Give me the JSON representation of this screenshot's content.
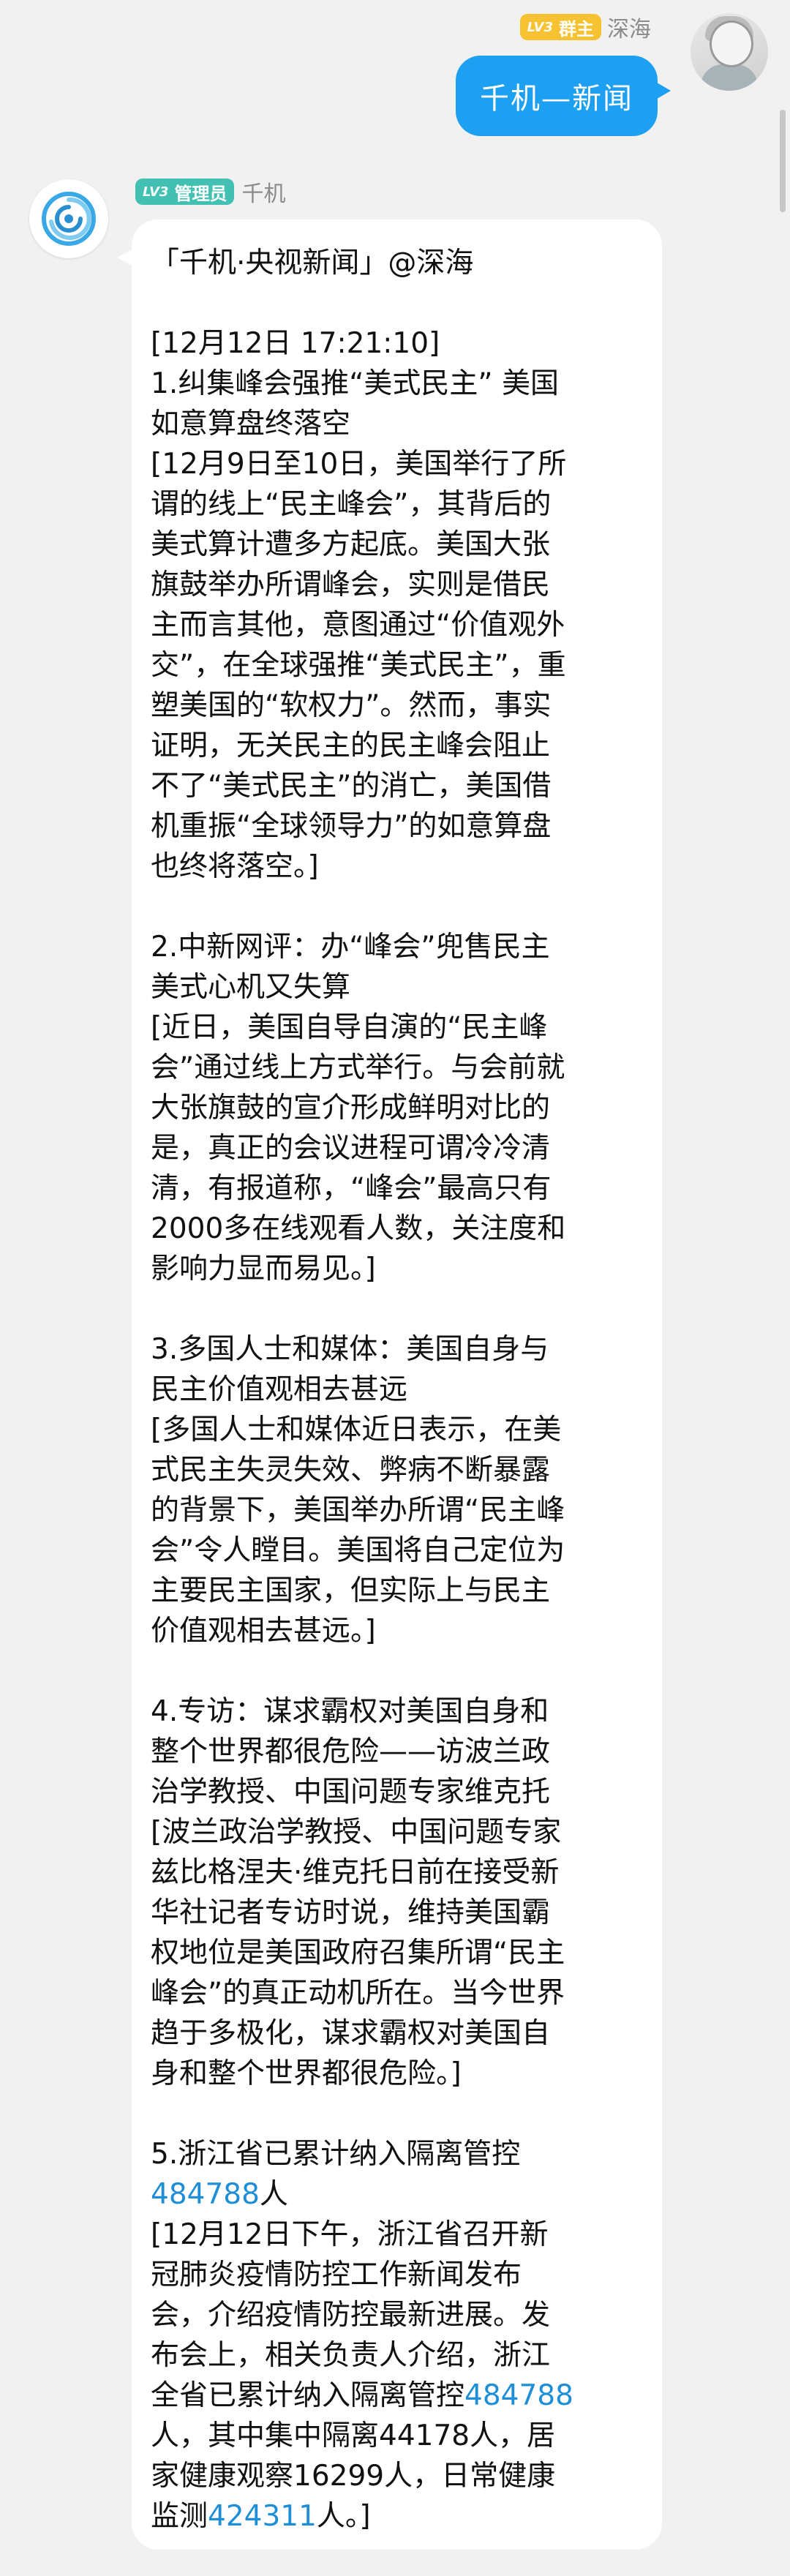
{
  "outgoing": {
    "badge_level": "LV3",
    "badge_role": "群主",
    "sender": "深海",
    "text": "千机—新闻"
  },
  "incoming": {
    "badge_level": "LV3",
    "badge_role": "管理员",
    "sender": "千机",
    "lines": [
      "「千机·央视新闻」@深海",
      "",
      "[12月12日 17:21:10]",
      "1.纠集峰会强推“美式民主” 美国",
      "如意算盘终落空",
      "[12月9日至10日，美国举行了所",
      "谓的线上“民主峰会”，其背后的",
      "美式算计遭多方起底。美国大张",
      "旗鼓举办所谓峰会，实则是借民",
      "主而言其他，意图通过“价值观外",
      "交”，在全球强推“美式民主”，重",
      "塑美国的“软权力”。然而，事实",
      "证明，无关民主的民主峰会阻止",
      "不了“美式民主”的消亡，美国借",
      "机重振“全球领导力”的如意算盘",
      "也终将落空。]",
      "",
      "2.中新网评：办“峰会”兜售民主",
      "美式心机又失算",
      "[近日，美国自导自演的“民主峰",
      "会”通过线上方式举行。与会前就",
      "大张旗鼓的宣介形成鲜明对比的",
      "是，真正的会议进程可谓冷冷清",
      "清，有报道称，“峰会”最高只有",
      "2000多在线观看人数，关注度和",
      "影响力显而易见。]",
      "",
      "3.多国人士和媒体：美国自身与",
      "民主价值观相去甚远",
      "[多国人士和媒体近日表示，在美",
      "式民主失灵失效、弊病不断暴露",
      "的背景下，美国举办所谓“民主峰",
      "会”令人瞠目。美国将自己定位为",
      "主要民主国家，但实际上与民主",
      "价值观相去甚远。]",
      "",
      "4.专访：谋求霸权对美国自身和",
      "整个世界都很危险——访波兰政",
      "治学教授、中国问题专家维克托",
      "[波兰政治学教授、中国问题专家",
      "兹比格涅夫·维克托日前在接受新",
      "华社记者专访时说，维持美国霸",
      "权地位是美国政府召集所谓“民主",
      "峰会”的真正动机所在。当今世界",
      "趋于多极化，谋求霸权对美国自",
      "身和整个世界都很危险。]",
      "",
      "5.浙江省已累计纳入隔离管控"
    ],
    "item5": {
      "link1": "484788",
      "after1": "人",
      "l1": "[12月12日下午，浙江省召开新",
      "l2": "冠肺炎疫情防控工作新闻发布",
      "l3": "会，介绍疫情防控最新进展。发",
      "l4": "布会上，相关负责人介绍，浙江",
      "l5_before": "全省已累计纳入隔离管控",
      "l5_link": "484788",
      "l6": "人，其中集中隔离44178人，居",
      "l7": "家健康观察16299人，日常健康",
      "l8_before": "监测",
      "l8_link": "424311",
      "l8_after": "人。]"
    }
  },
  "colors": {
    "outgoing_bubble": "#1ea0f2",
    "link": "#1e8fd6",
    "owner_badge": "#f6c232",
    "admin_badge": "#42c1b2"
  }
}
